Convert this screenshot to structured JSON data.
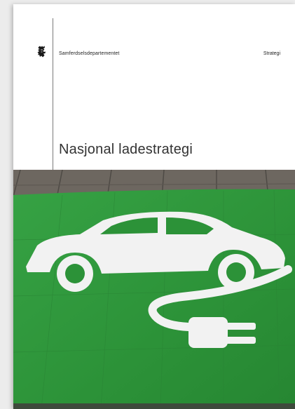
{
  "cover": {
    "department": "Samferdselsdepartementet",
    "document_type": "Strategi",
    "title": "Nasjonal ladestrategi",
    "crest_icon": "norwegian-lion-crest-icon",
    "photo_icon": "ev-charging-car-plug-icon",
    "colors": {
      "pavement_green": "#2f9a3c",
      "asphalt": "#6d6760",
      "marking_white": "#f2f2f2"
    }
  }
}
